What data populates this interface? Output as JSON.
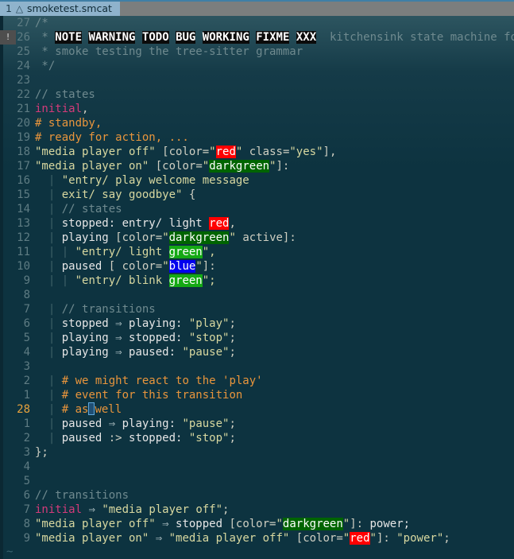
{
  "window": {
    "app": "vim-text-editor",
    "accent_blue": "#3f7fa6",
    "background": "#0d3340"
  },
  "tabline": {
    "tabs": [
      {
        "number": "1",
        "icon": "file-type-icon",
        "icon_glyph": "△",
        "filename": "smoketest.smcat",
        "active": true
      }
    ]
  },
  "editor": {
    "cursor_line_number": "28",
    "empty_marker": "~",
    "sign_error": "!",
    "indent_guide": "|",
    "lines": [
      {
        "n": "27",
        "sign": "",
        "tokens": [
          {
            "t": "/*",
            "c": "cmt"
          }
        ]
      },
      {
        "n": "26",
        "sign": "!",
        "tokens": [
          {
            "t": " * ",
            "c": "cmt"
          },
          {
            "t": "NOTE",
            "c": "todo"
          },
          {
            "t": " ",
            "c": "cmt"
          },
          {
            "t": "WARNING",
            "c": "todo"
          },
          {
            "t": " ",
            "c": "cmt"
          },
          {
            "t": "TODO",
            "c": "todo"
          },
          {
            "t": " ",
            "c": "cmt"
          },
          {
            "t": "BUG",
            "c": "todo"
          },
          {
            "t": " ",
            "c": "cmt"
          },
          {
            "t": "WORKING",
            "c": "todo"
          },
          {
            "t": " ",
            "c": "cmt"
          },
          {
            "t": "FIXME",
            "c": "todo"
          },
          {
            "t": " ",
            "c": "cmt"
          },
          {
            "t": "XXX",
            "c": "todo"
          },
          {
            "t": "  kitchensink state machine for",
            "c": "cmt"
          }
        ]
      },
      {
        "n": "25",
        "sign": "",
        "tokens": [
          {
            "t": " * smoke testing the tree-sitter grammar",
            "c": "cmt"
          }
        ]
      },
      {
        "n": "24",
        "sign": "",
        "tokens": [
          {
            "t": " */",
            "c": "cmt"
          }
        ]
      },
      {
        "n": "23",
        "sign": "",
        "tokens": []
      },
      {
        "n": "22",
        "sign": "",
        "tokens": [
          {
            "t": "// states",
            "c": "cmt"
          }
        ]
      },
      {
        "n": "21",
        "sign": "",
        "tokens": [
          {
            "t": "initial",
            "c": "kw"
          },
          {
            "t": ",",
            "c": "punct"
          }
        ]
      },
      {
        "n": "20",
        "sign": "",
        "tokens": [
          {
            "t": "# standby,",
            "c": "hash"
          }
        ]
      },
      {
        "n": "19",
        "sign": "",
        "tokens": [
          {
            "t": "# ready for action, ...",
            "c": "hash"
          }
        ]
      },
      {
        "n": "18",
        "sign": "",
        "tokens": [
          {
            "t": "\"media player off\"",
            "c": "str"
          },
          {
            "t": " [",
            "c": "punct"
          },
          {
            "t": "color",
            "c": "attr"
          },
          {
            "t": "=",
            "c": "punct"
          },
          {
            "t": "\"",
            "c": "str"
          },
          {
            "t": "red",
            "c": "c-red"
          },
          {
            "t": "\"",
            "c": "str"
          },
          {
            "t": " ",
            "c": "punct"
          },
          {
            "t": "class",
            "c": "attr"
          },
          {
            "t": "=",
            "c": "punct"
          },
          {
            "t": "\"yes\"",
            "c": "str"
          },
          {
            "t": "],",
            "c": "punct"
          }
        ]
      },
      {
        "n": "17",
        "sign": "",
        "tokens": [
          {
            "t": "\"media player on\"",
            "c": "str"
          },
          {
            "t": " [",
            "c": "punct"
          },
          {
            "t": "color",
            "c": "attr"
          },
          {
            "t": "=",
            "c": "punct"
          },
          {
            "t": "\"",
            "c": "str"
          },
          {
            "t": "darkgreen",
            "c": "c-darkgreen"
          },
          {
            "t": "\"",
            "c": "str"
          },
          {
            "t": "]:",
            "c": "punct"
          }
        ]
      },
      {
        "n": "16",
        "sign": "",
        "tokens": [
          {
            "t": "  |",
            "c": "guide"
          },
          {
            "t": " \"entry/ play welcome message",
            "c": "str"
          }
        ]
      },
      {
        "n": "15",
        "sign": "",
        "tokens": [
          {
            "t": "  |",
            "c": "guide"
          },
          {
            "t": " exit/ say goodbye\"",
            "c": "str"
          },
          {
            "t": " {",
            "c": "punct"
          }
        ]
      },
      {
        "n": "14",
        "sign": "",
        "tokens": [
          {
            "t": "  |",
            "c": "guide"
          },
          {
            "t": " // states",
            "c": "cmt"
          }
        ]
      },
      {
        "n": "13",
        "sign": "",
        "tokens": [
          {
            "t": "  |",
            "c": "guide"
          },
          {
            "t": " stopped: entry/ light ",
            "c": "plain"
          },
          {
            "t": "red",
            "c": "c-red"
          },
          {
            "t": ",",
            "c": "punct"
          }
        ]
      },
      {
        "n": "12",
        "sign": "",
        "tokens": [
          {
            "t": "  |",
            "c": "guide"
          },
          {
            "t": " playing",
            "c": "plain"
          },
          {
            "t": " [",
            "c": "punct"
          },
          {
            "t": "color",
            "c": "attr"
          },
          {
            "t": "=",
            "c": "punct"
          },
          {
            "t": "\"",
            "c": "str"
          },
          {
            "t": "darkgreen",
            "c": "c-darkgreen"
          },
          {
            "t": "\"",
            "c": "str"
          },
          {
            "t": " active]:",
            "c": "punct"
          }
        ]
      },
      {
        "n": "11",
        "sign": "",
        "tokens": [
          {
            "t": "  | |",
            "c": "guide"
          },
          {
            "t": " \"entry/ light ",
            "c": "str"
          },
          {
            "t": "green",
            "c": "c-green"
          },
          {
            "t": "\",",
            "c": "str"
          }
        ]
      },
      {
        "n": "10",
        "sign": "",
        "tokens": [
          {
            "t": "  |",
            "c": "guide"
          },
          {
            "t": " paused",
            "c": "plain"
          },
          {
            "t": " [ ",
            "c": "punct"
          },
          {
            "t": "color",
            "c": "attr"
          },
          {
            "t": "=",
            "c": "punct"
          },
          {
            "t": "\"",
            "c": "str"
          },
          {
            "t": "blue",
            "c": "c-blue"
          },
          {
            "t": "\"",
            "c": "str"
          },
          {
            "t": "]:",
            "c": "punct"
          }
        ]
      },
      {
        "n": "9",
        "sign": "",
        "tokens": [
          {
            "t": "  | |",
            "c": "guide"
          },
          {
            "t": " \"entry/ blink ",
            "c": "str"
          },
          {
            "t": "green",
            "c": "c-green"
          },
          {
            "t": "\";",
            "c": "str"
          }
        ]
      },
      {
        "n": "8",
        "sign": "",
        "tokens": []
      },
      {
        "n": "7",
        "sign": "",
        "tokens": [
          {
            "t": "  |",
            "c": "guide"
          },
          {
            "t": " // transitions",
            "c": "cmt"
          }
        ]
      },
      {
        "n": "6",
        "sign": "",
        "tokens": [
          {
            "t": "  |",
            "c": "guide"
          },
          {
            "t": " stopped ",
            "c": "plain"
          },
          {
            "t": "⇒",
            "c": "arrow"
          },
          {
            "t": " playing:",
            "c": "plain"
          },
          {
            "t": " \"play\"",
            "c": "str"
          },
          {
            "t": ";",
            "c": "punct"
          }
        ]
      },
      {
        "n": "5",
        "sign": "",
        "tokens": [
          {
            "t": "  |",
            "c": "guide"
          },
          {
            "t": " playing ",
            "c": "plain"
          },
          {
            "t": "⇒",
            "c": "arrow"
          },
          {
            "t": " stopped:",
            "c": "plain"
          },
          {
            "t": " \"stop\"",
            "c": "str"
          },
          {
            "t": ";",
            "c": "punct"
          }
        ]
      },
      {
        "n": "4",
        "sign": "",
        "tokens": [
          {
            "t": "  |",
            "c": "guide"
          },
          {
            "t": " playing ",
            "c": "plain"
          },
          {
            "t": "⇒",
            "c": "arrow"
          },
          {
            "t": " paused:",
            "c": "plain"
          },
          {
            "t": " \"pause\"",
            "c": "str"
          },
          {
            "t": ";",
            "c": "punct"
          }
        ]
      },
      {
        "n": "3",
        "sign": "",
        "tokens": []
      },
      {
        "n": "2",
        "sign": "",
        "tokens": [
          {
            "t": "  |",
            "c": "guide"
          },
          {
            "t": " # we might react to the 'play'",
            "c": "hash"
          }
        ]
      },
      {
        "n": "1",
        "sign": "",
        "tokens": [
          {
            "t": "  |",
            "c": "guide"
          },
          {
            "t": " # event for this transition",
            "c": "hash"
          }
        ]
      },
      {
        "n": "28",
        "sign": "",
        "current": true,
        "tokens": [
          {
            "t": "  |",
            "c": "guide"
          },
          {
            "t": " # as",
            "c": "hash"
          },
          {
            "t": "",
            "c": "cursor"
          },
          {
            "t": "well",
            "c": "hash"
          }
        ]
      },
      {
        "n": "1",
        "sign": "",
        "tokens": [
          {
            "t": "  |",
            "c": "guide"
          },
          {
            "t": " paused ",
            "c": "plain"
          },
          {
            "t": "⇒",
            "c": "arrow"
          },
          {
            "t": " playing:",
            "c": "plain"
          },
          {
            "t": " \"pause\"",
            "c": "str"
          },
          {
            "t": ";",
            "c": "punct"
          }
        ]
      },
      {
        "n": "2",
        "sign": "",
        "tokens": [
          {
            "t": "  |",
            "c": "guide"
          },
          {
            "t": " paused ",
            "c": "plain"
          },
          {
            "t": ":>",
            "c": "punct"
          },
          {
            "t": " stopped:",
            "c": "plain"
          },
          {
            "t": " \"stop\"",
            "c": "str"
          },
          {
            "t": ";",
            "c": "punct"
          }
        ]
      },
      {
        "n": "3",
        "sign": "",
        "tokens": [
          {
            "t": "};",
            "c": "punct"
          }
        ]
      },
      {
        "n": "4",
        "sign": "",
        "tokens": []
      },
      {
        "n": "5",
        "sign": "",
        "tokens": []
      },
      {
        "n": "6",
        "sign": "",
        "tokens": [
          {
            "t": "// transitions",
            "c": "cmt"
          }
        ]
      },
      {
        "n": "7",
        "sign": "",
        "tokens": [
          {
            "t": "initial",
            "c": "kw"
          },
          {
            "t": " ",
            "c": "plain"
          },
          {
            "t": "⇒",
            "c": "arrow"
          },
          {
            "t": " \"media player off\"",
            "c": "str"
          },
          {
            "t": ";",
            "c": "punct"
          }
        ]
      },
      {
        "n": "8",
        "sign": "",
        "tokens": [
          {
            "t": "\"media player off\"",
            "c": "str"
          },
          {
            "t": " ",
            "c": "plain"
          },
          {
            "t": "⇒",
            "c": "arrow"
          },
          {
            "t": " stopped",
            "c": "plain"
          },
          {
            "t": " [",
            "c": "punct"
          },
          {
            "t": "color",
            "c": "attr"
          },
          {
            "t": "=",
            "c": "punct"
          },
          {
            "t": "\"",
            "c": "str"
          },
          {
            "t": "darkgreen",
            "c": "c-darkgreen"
          },
          {
            "t": "\"",
            "c": "str"
          },
          {
            "t": "]:",
            "c": "punct"
          },
          {
            "t": " power;",
            "c": "plain"
          }
        ]
      },
      {
        "n": "9",
        "sign": "",
        "tokens": [
          {
            "t": "\"media player on\"",
            "c": "str"
          },
          {
            "t": " ",
            "c": "plain"
          },
          {
            "t": "⇒",
            "c": "arrow"
          },
          {
            "t": " \"media player off\"",
            "c": "str"
          },
          {
            "t": " [",
            "c": "punct"
          },
          {
            "t": "color",
            "c": "attr"
          },
          {
            "t": "=",
            "c": "punct"
          },
          {
            "t": "\"",
            "c": "str"
          },
          {
            "t": "red",
            "c": "c-red"
          },
          {
            "t": "\"",
            "c": "str"
          },
          {
            "t": "]:",
            "c": "punct"
          },
          {
            "t": " \"power\"",
            "c": "str"
          },
          {
            "t": ";",
            "c": "punct"
          }
        ]
      }
    ]
  }
}
